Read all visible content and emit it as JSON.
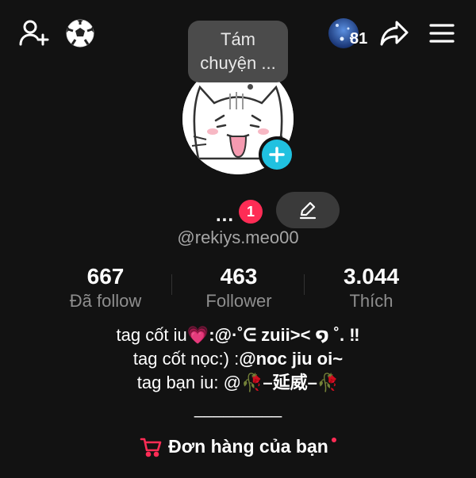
{
  "topbar": {
    "left_icons": [
      "add-friend-icon",
      "soccer-ball-icon"
    ],
    "story_count": "81",
    "right_icons": [
      "share-icon",
      "menu-icon"
    ]
  },
  "bubble": {
    "line1": "Tám",
    "line2": "chuyện ..."
  },
  "profile": {
    "name": "...",
    "notification_count": "1",
    "handle": "@rekiys.meo00"
  },
  "stats": [
    {
      "value": "667",
      "label": "Đã follow"
    },
    {
      "value": "463",
      "label": "Follower"
    },
    {
      "value": "3.044",
      "label": "Thích"
    }
  ],
  "bio": {
    "line1_prefix": "tag cốt iu",
    "line1_emoji": "💗",
    "line1_suffix": ":@·˚ᕮ zuii>< ໑ ˚. ‼",
    "line2_prefix": "tag cốt nọc:) :",
    "line2_bold": "@noc jiu oi~",
    "line3_prefix": "tag bạn iu: @",
    "line3_emoji1": "🥀",
    "line3_mid": "–延威–",
    "line3_emoji2": "🥀",
    "line4": "_________"
  },
  "orders": {
    "label": "Đơn hàng của bạn"
  },
  "colors": {
    "accent": "#fe2c55",
    "plus_badge": "#20c1e0",
    "background": "#121212"
  }
}
